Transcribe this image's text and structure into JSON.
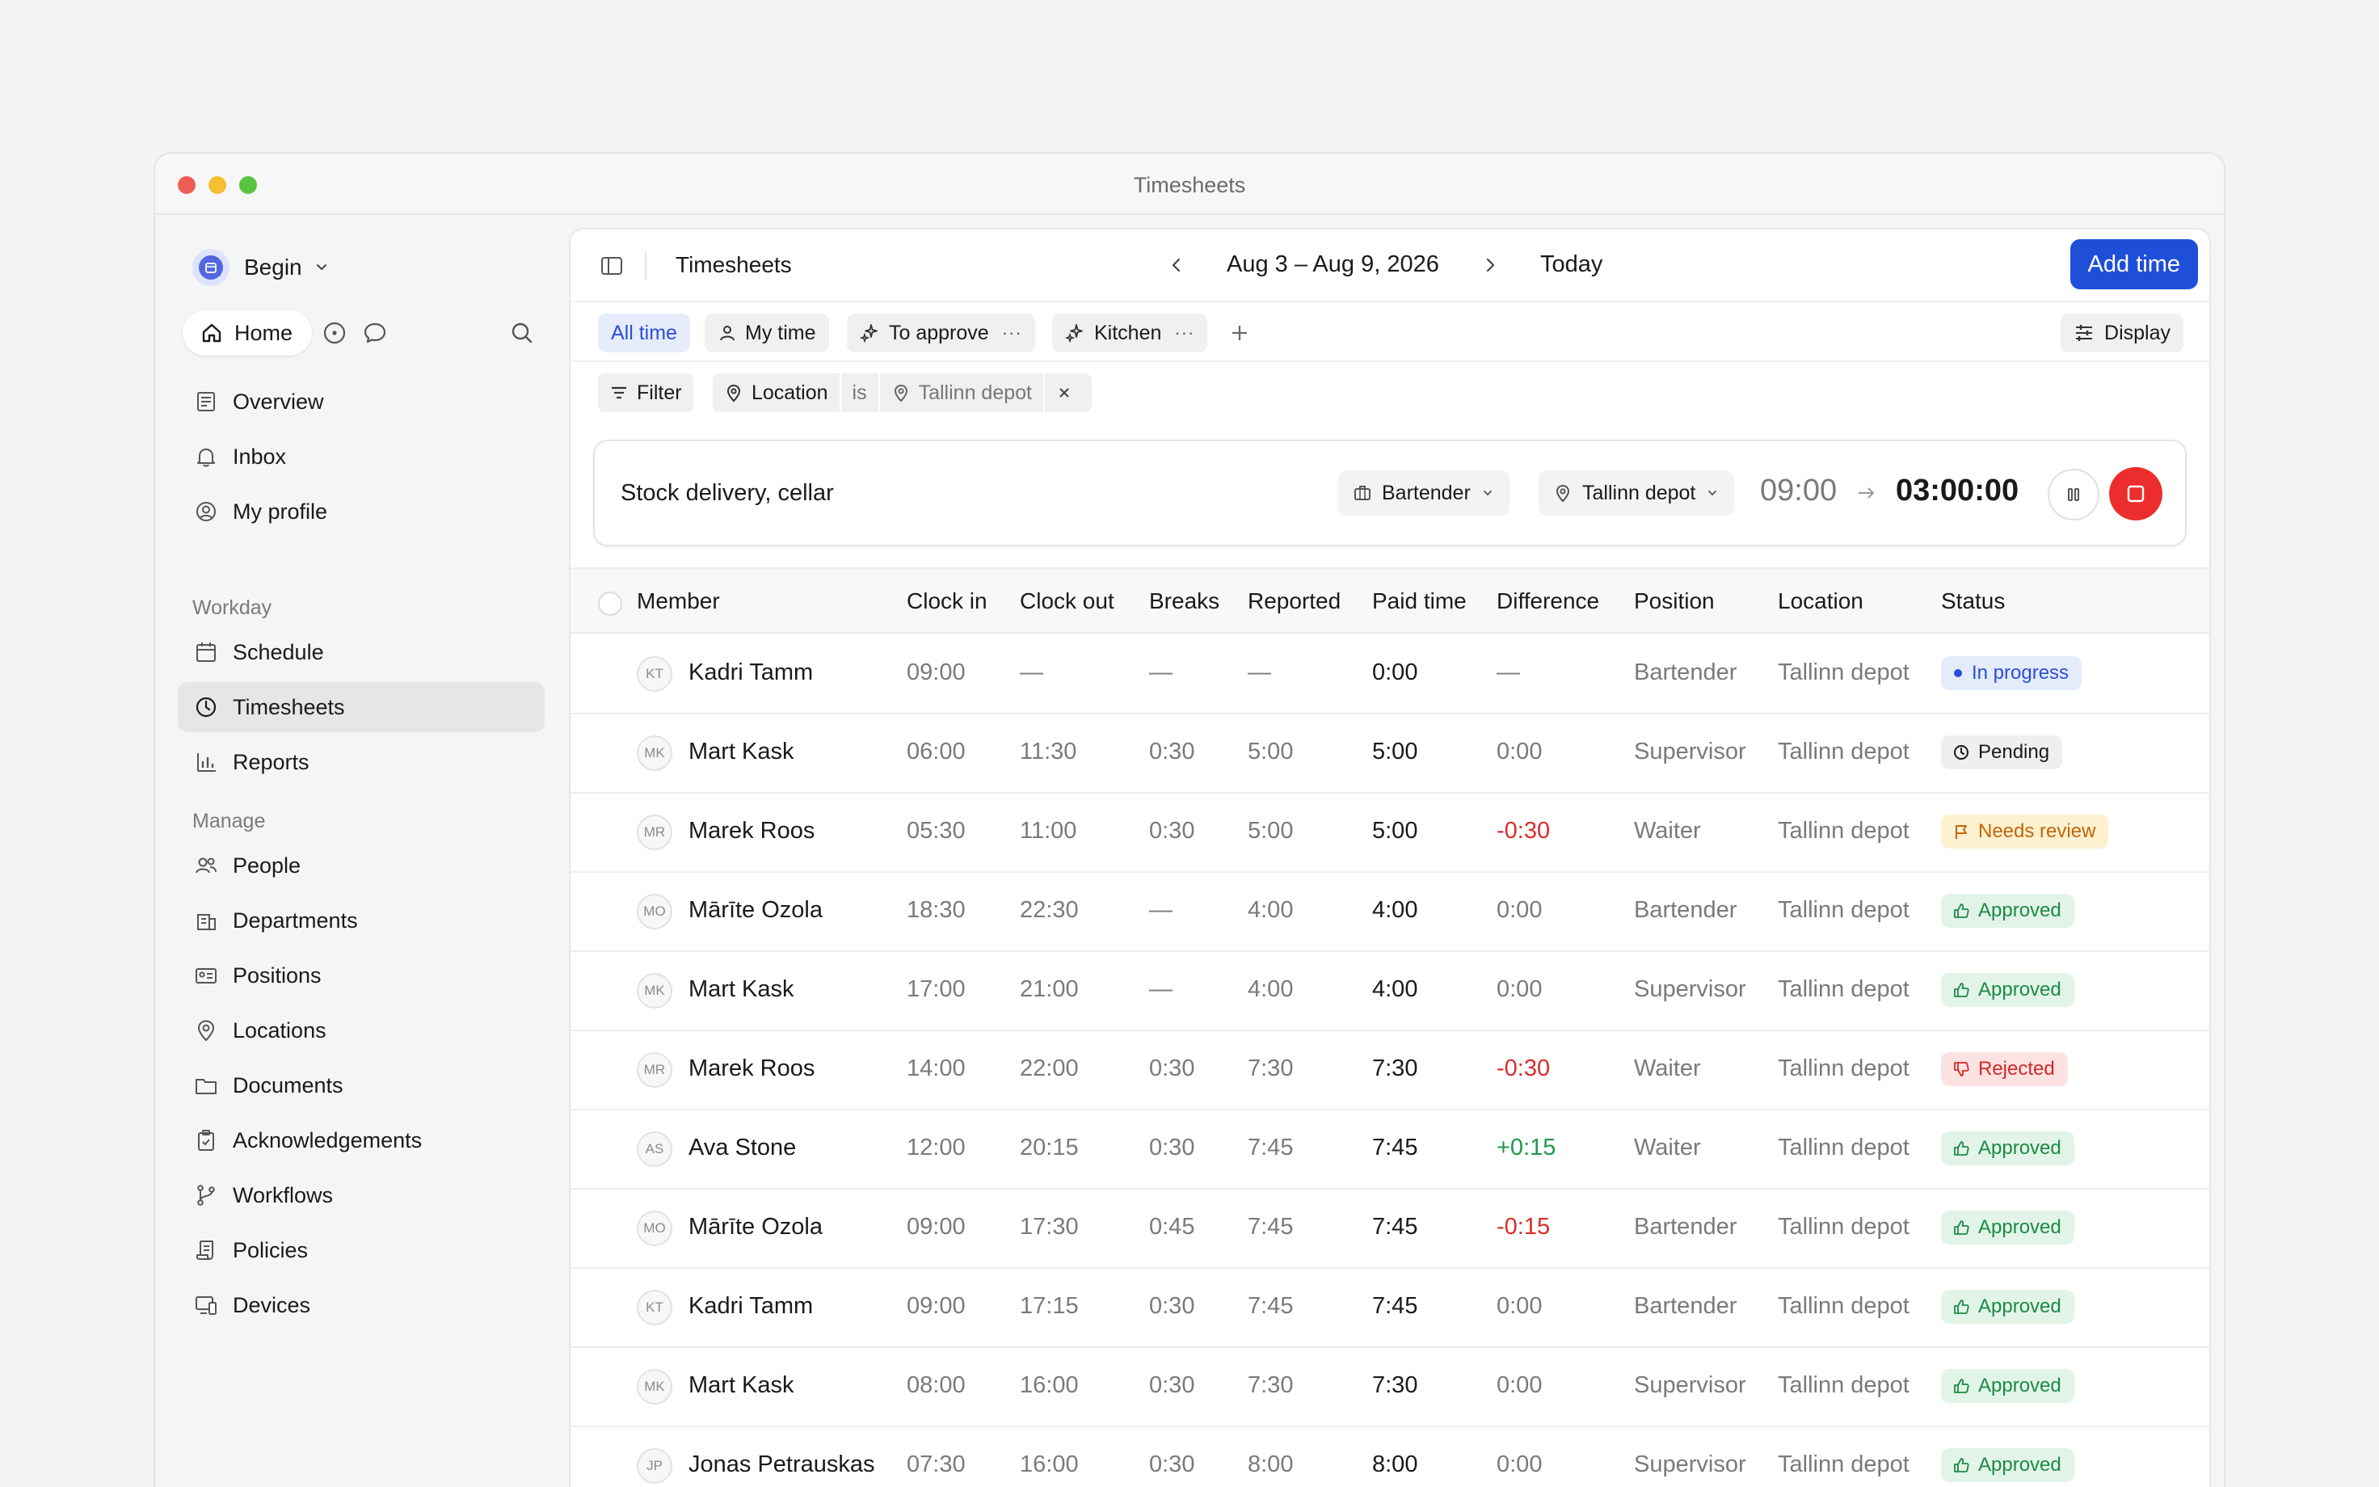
{
  "window": {
    "title": "Timesheets"
  },
  "sidebar": {
    "workspace": "Begin",
    "home_label": "Home",
    "items_top": [
      {
        "label": "Overview",
        "icon": "overview-icon"
      },
      {
        "label": "Inbox",
        "icon": "bell-icon"
      },
      {
        "label": "My profile",
        "icon": "user-circle-icon"
      }
    ],
    "section_workday": "Workday",
    "items_workday": [
      {
        "label": "Schedule",
        "icon": "calendar-icon"
      },
      {
        "label": "Timesheets",
        "icon": "clock-icon",
        "active": true
      },
      {
        "label": "Reports",
        "icon": "bar-chart-icon"
      }
    ],
    "section_manage": "Manage",
    "items_manage": [
      {
        "label": "People",
        "icon": "people-icon"
      },
      {
        "label": "Departments",
        "icon": "building-icon"
      },
      {
        "label": "Positions",
        "icon": "id-card-icon"
      },
      {
        "label": "Locations",
        "icon": "map-pin-icon"
      },
      {
        "label": "Documents",
        "icon": "folder-icon"
      },
      {
        "label": "Acknowledgements",
        "icon": "clipboard-icon"
      },
      {
        "label": "Workflows",
        "icon": "branch-icon"
      },
      {
        "label": "Policies",
        "icon": "scroll-icon"
      },
      {
        "label": "Devices",
        "icon": "devices-icon"
      }
    ]
  },
  "toolbar": {
    "title": "Timesheets",
    "date_range": "Aug 3 – Aug 9, 2026",
    "today_label": "Today",
    "add_time_label": "Add time"
  },
  "views": {
    "tabs": [
      "All time",
      "My time",
      "To approve",
      "Kitchen"
    ],
    "more": "···",
    "display_label": "Display"
  },
  "filters": {
    "filter_label": "Filter",
    "field": "Location",
    "operator": "is",
    "value": "Tallinn depot"
  },
  "timer": {
    "description": "Stock delivery, cellar",
    "position": "Bartender",
    "location": "Tallinn depot",
    "start": "09:00",
    "elapsed": "03:00:00"
  },
  "table": {
    "columns": [
      "Member",
      "Clock in",
      "Clock out",
      "Breaks",
      "Reported",
      "Paid time",
      "Difference",
      "Position",
      "Location",
      "Status"
    ],
    "rows": [
      {
        "initials": "KT",
        "member": "Kadri Tamm",
        "clock_in": "09:00",
        "clock_out": "—",
        "breaks": "—",
        "reported": "—",
        "paid": "0:00",
        "difference": "—",
        "diff_type": "neutral",
        "position": "Bartender",
        "location": "Tallinn depot",
        "status": "In progress",
        "status_type": "progress"
      },
      {
        "initials": "MK",
        "member": "Mart Kask",
        "clock_in": "06:00",
        "clock_out": "11:30",
        "breaks": "0:30",
        "reported": "5:00",
        "paid": "5:00",
        "difference": "0:00",
        "diff_type": "neutral",
        "position": "Supervisor",
        "location": "Tallinn depot",
        "status": "Pending",
        "status_type": "pending"
      },
      {
        "initials": "MR",
        "member": "Marek Roos",
        "clock_in": "05:30",
        "clock_out": "11:00",
        "breaks": "0:30",
        "reported": "5:00",
        "paid": "5:00",
        "difference": "-0:30",
        "diff_type": "neg",
        "position": "Waiter",
        "location": "Tallinn depot",
        "status": "Needs review",
        "status_type": "review"
      },
      {
        "initials": "MO",
        "member": "Mārīte Ozola",
        "clock_in": "18:30",
        "clock_out": "22:30",
        "breaks": "—",
        "reported": "4:00",
        "paid": "4:00",
        "difference": "0:00",
        "diff_type": "neutral",
        "position": "Bartender",
        "location": "Tallinn depot",
        "status": "Approved",
        "status_type": "approved"
      },
      {
        "initials": "MK",
        "member": "Mart Kask",
        "clock_in": "17:00",
        "clock_out": "21:00",
        "breaks": "—",
        "reported": "4:00",
        "paid": "4:00",
        "difference": "0:00",
        "diff_type": "neutral",
        "position": "Supervisor",
        "location": "Tallinn depot",
        "status": "Approved",
        "status_type": "approved"
      },
      {
        "initials": "MR",
        "member": "Marek Roos",
        "clock_in": "14:00",
        "clock_out": "22:00",
        "breaks": "0:30",
        "reported": "7:30",
        "paid": "7:30",
        "difference": "-0:30",
        "diff_type": "neg",
        "position": "Waiter",
        "location": "Tallinn depot",
        "status": "Rejected",
        "status_type": "rejected"
      },
      {
        "initials": "AS",
        "member": "Ava Stone",
        "clock_in": "12:00",
        "clock_out": "20:15",
        "breaks": "0:30",
        "reported": "7:45",
        "paid": "7:45",
        "difference": "+0:15",
        "diff_type": "pos",
        "position": "Waiter",
        "location": "Tallinn depot",
        "status": "Approved",
        "status_type": "approved"
      },
      {
        "initials": "MO",
        "member": "Mārīte Ozola",
        "clock_in": "09:00",
        "clock_out": "17:30",
        "breaks": "0:45",
        "reported": "7:45",
        "paid": "7:45",
        "difference": "-0:15",
        "diff_type": "neg",
        "position": "Bartender",
        "location": "Tallinn depot",
        "status": "Approved",
        "status_type": "approved"
      },
      {
        "initials": "KT",
        "member": "Kadri Tamm",
        "clock_in": "09:00",
        "clock_out": "17:15",
        "breaks": "0:30",
        "reported": "7:45",
        "paid": "7:45",
        "difference": "0:00",
        "diff_type": "neutral",
        "position": "Bartender",
        "location": "Tallinn depot",
        "status": "Approved",
        "status_type": "approved"
      },
      {
        "initials": "MK",
        "member": "Mart Kask",
        "clock_in": "08:00",
        "clock_out": "16:00",
        "breaks": "0:30",
        "reported": "7:30",
        "paid": "7:30",
        "difference": "0:00",
        "diff_type": "neutral",
        "position": "Supervisor",
        "location": "Tallinn depot",
        "status": "Approved",
        "status_type": "approved"
      },
      {
        "initials": "JP",
        "member": "Jonas Petrauskas",
        "clock_in": "07:30",
        "clock_out": "16:00",
        "breaks": "0:30",
        "reported": "8:00",
        "paid": "8:00",
        "difference": "0:00",
        "diff_type": "neutral",
        "position": "Supervisor",
        "location": "Tallinn depot",
        "status": "Approved",
        "status_type": "approved"
      }
    ]
  }
}
